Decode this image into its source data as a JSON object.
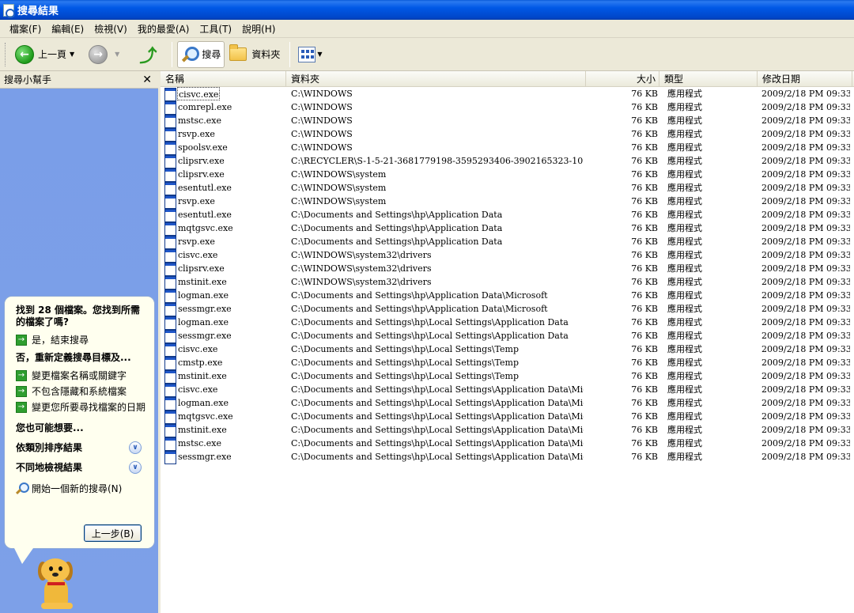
{
  "window": {
    "title": "搜尋結果"
  },
  "menu": [
    "檔案(F)",
    "編輯(E)",
    "檢視(V)",
    "我的最愛(A)",
    "工具(T)",
    "說明(H)"
  ],
  "toolbar": {
    "back_label": "上一頁",
    "search_label": "搜尋",
    "folders_label": "資料夾"
  },
  "left_pane": {
    "title": "搜尋小幫手",
    "found_text": "找到 28 個檔案。您找到所需的檔案了嗎?",
    "yes_label": "是，結束搜尋",
    "no_heading": "否，重新定義搜尋目標及...",
    "options": [
      "變更檔案名稱或關鍵字",
      "不包含隱藏和系統檔案",
      "變更您所要尋找檔案的日期"
    ],
    "maybe_heading": "您也可能想要...",
    "sort_label": "依類別排序結果",
    "view_label": "不同地檢視結果",
    "new_search_label": "開始一個新的搜尋(N)",
    "back_button": "上一步(B)"
  },
  "columns": {
    "name": "名稱",
    "folder": "資料夾",
    "size": "大小",
    "type": "類型",
    "modified": "修改日期"
  },
  "files": [
    {
      "name": "cisvc.exe",
      "folder": "C:\\WINDOWS",
      "size": "76 KB",
      "type": "應用程式",
      "modified": "2009/2/18 PM 09:33"
    },
    {
      "name": "comrepl.exe",
      "folder": "C:\\WINDOWS",
      "size": "76 KB",
      "type": "應用程式",
      "modified": "2009/2/18 PM 09:33"
    },
    {
      "name": "mstsc.exe",
      "folder": "C:\\WINDOWS",
      "size": "76 KB",
      "type": "應用程式",
      "modified": "2009/2/18 PM 09:33"
    },
    {
      "name": "rsvp.exe",
      "folder": "C:\\WINDOWS",
      "size": "76 KB",
      "type": "應用程式",
      "modified": "2009/2/18 PM 09:33"
    },
    {
      "name": "spoolsv.exe",
      "folder": "C:\\WINDOWS",
      "size": "76 KB",
      "type": "應用程式",
      "modified": "2009/2/18 PM 09:33"
    },
    {
      "name": "clipsrv.exe",
      "folder": "C:\\RECYCLER\\S-1-5-21-3681779198-3595293406-3902165323-1006",
      "size": "76 KB",
      "type": "應用程式",
      "modified": "2009/2/18 PM 09:33"
    },
    {
      "name": "clipsrv.exe",
      "folder": "C:\\WINDOWS\\system",
      "size": "76 KB",
      "type": "應用程式",
      "modified": "2009/2/18 PM 09:33"
    },
    {
      "name": "esentutl.exe",
      "folder": "C:\\WINDOWS\\system",
      "size": "76 KB",
      "type": "應用程式",
      "modified": "2009/2/18 PM 09:33"
    },
    {
      "name": "rsvp.exe",
      "folder": "C:\\WINDOWS\\system",
      "size": "76 KB",
      "type": "應用程式",
      "modified": "2009/2/18 PM 09:33"
    },
    {
      "name": "esentutl.exe",
      "folder": "C:\\Documents and Settings\\hp\\Application Data",
      "size": "76 KB",
      "type": "應用程式",
      "modified": "2009/2/18 PM 09:33"
    },
    {
      "name": "mqtgsvc.exe",
      "folder": "C:\\Documents and Settings\\hp\\Application Data",
      "size": "76 KB",
      "type": "應用程式",
      "modified": "2009/2/18 PM 09:33"
    },
    {
      "name": "rsvp.exe",
      "folder": "C:\\Documents and Settings\\hp\\Application Data",
      "size": "76 KB",
      "type": "應用程式",
      "modified": "2009/2/18 PM 09:33"
    },
    {
      "name": "cisvc.exe",
      "folder": "C:\\WINDOWS\\system32\\drivers",
      "size": "76 KB",
      "type": "應用程式",
      "modified": "2009/2/18 PM 09:33"
    },
    {
      "name": "clipsrv.exe",
      "folder": "C:\\WINDOWS\\system32\\drivers",
      "size": "76 KB",
      "type": "應用程式",
      "modified": "2009/2/18 PM 09:33"
    },
    {
      "name": "mstinit.exe",
      "folder": "C:\\WINDOWS\\system32\\drivers",
      "size": "76 KB",
      "type": "應用程式",
      "modified": "2009/2/18 PM 09:33"
    },
    {
      "name": "logman.exe",
      "folder": "C:\\Documents and Settings\\hp\\Application Data\\Microsoft",
      "size": "76 KB",
      "type": "應用程式",
      "modified": "2009/2/18 PM 09:33"
    },
    {
      "name": "sessmgr.exe",
      "folder": "C:\\Documents and Settings\\hp\\Application Data\\Microsoft",
      "size": "76 KB",
      "type": "應用程式",
      "modified": "2009/2/18 PM 09:33"
    },
    {
      "name": "logman.exe",
      "folder": "C:\\Documents and Settings\\hp\\Local Settings\\Application Data",
      "size": "76 KB",
      "type": "應用程式",
      "modified": "2009/2/18 PM 09:33"
    },
    {
      "name": "sessmgr.exe",
      "folder": "C:\\Documents and Settings\\hp\\Local Settings\\Application Data",
      "size": "76 KB",
      "type": "應用程式",
      "modified": "2009/2/18 PM 09:33"
    },
    {
      "name": "cisvc.exe",
      "folder": "C:\\Documents and Settings\\hp\\Local Settings\\Temp",
      "size": "76 KB",
      "type": "應用程式",
      "modified": "2009/2/18 PM 09:33"
    },
    {
      "name": "cmstp.exe",
      "folder": "C:\\Documents and Settings\\hp\\Local Settings\\Temp",
      "size": "76 KB",
      "type": "應用程式",
      "modified": "2009/2/18 PM 09:33"
    },
    {
      "name": "mstinit.exe",
      "folder": "C:\\Documents and Settings\\hp\\Local Settings\\Temp",
      "size": "76 KB",
      "type": "應用程式",
      "modified": "2009/2/18 PM 09:33"
    },
    {
      "name": "cisvc.exe",
      "folder": "C:\\Documents and Settings\\hp\\Local Settings\\Application Data\\Microsoft",
      "size": "76 KB",
      "type": "應用程式",
      "modified": "2009/2/18 PM 09:33"
    },
    {
      "name": "logman.exe",
      "folder": "C:\\Documents and Settings\\hp\\Local Settings\\Application Data\\Microsoft",
      "size": "76 KB",
      "type": "應用程式",
      "modified": "2009/2/18 PM 09:33"
    },
    {
      "name": "mqtgsvc.exe",
      "folder": "C:\\Documents and Settings\\hp\\Local Settings\\Application Data\\Microsoft",
      "size": "76 KB",
      "type": "應用程式",
      "modified": "2009/2/18 PM 09:33"
    },
    {
      "name": "mstinit.exe",
      "folder": "C:\\Documents and Settings\\hp\\Local Settings\\Application Data\\Microsoft",
      "size": "76 KB",
      "type": "應用程式",
      "modified": "2009/2/18 PM 09:33"
    },
    {
      "name": "mstsc.exe",
      "folder": "C:\\Documents and Settings\\hp\\Local Settings\\Application Data\\Microsoft",
      "size": "76 KB",
      "type": "應用程式",
      "modified": "2009/2/18 PM 09:33"
    },
    {
      "name": "sessmgr.exe",
      "folder": "C:\\Documents and Settings\\hp\\Local Settings\\Application Data\\Microsoft",
      "size": "76 KB",
      "type": "應用程式",
      "modified": "2009/2/18 PM 09:33"
    }
  ]
}
